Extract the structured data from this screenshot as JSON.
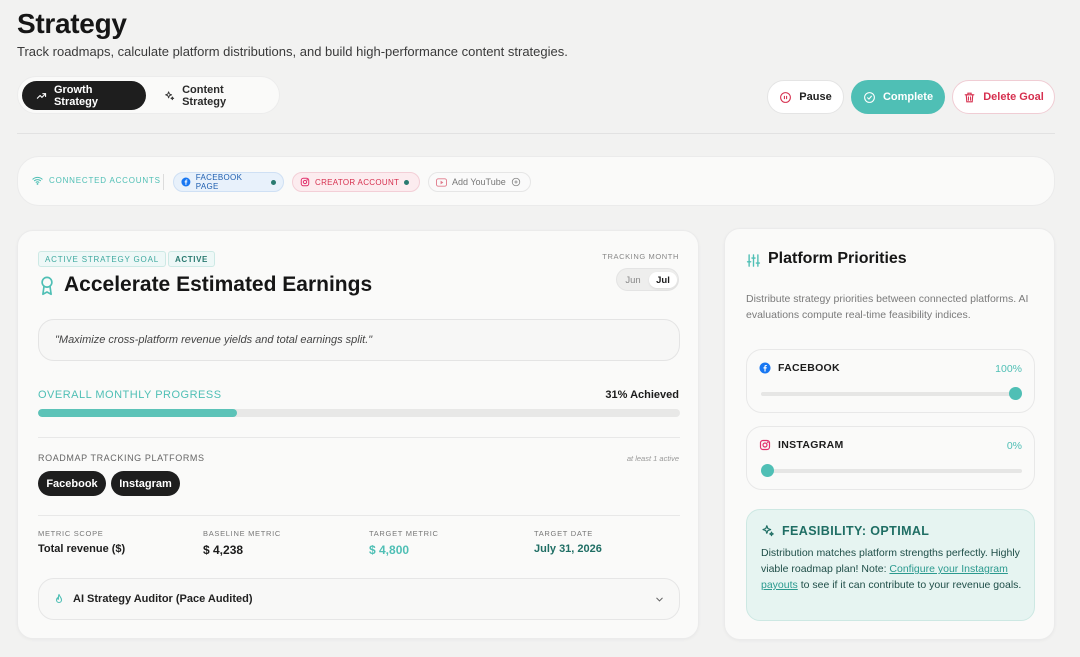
{
  "header": {
    "title": "Strategy",
    "subtitle": "Track roadmaps, calculate platform distributions, and build high-performance content strategies."
  },
  "tabs": [
    {
      "label": "Growth Strategy",
      "icon": "trending-up-icon",
      "active": true
    },
    {
      "label": "Content Strategy",
      "icon": "sparkles-icon",
      "active": false
    }
  ],
  "actions": {
    "pause": "Pause",
    "complete": "Complete",
    "delete": "Delete Goal"
  },
  "accounts": {
    "label": "CONNECTED ACCOUNTS",
    "facebook": "FACEBOOK PAGE",
    "instagram": "CREATOR ACCOUNT",
    "youtube": "Add YouTube"
  },
  "goal": {
    "tag": "ACTIVE STRATEGY GOAL",
    "status": "ACTIVE",
    "title": "Accelerate Estimated Earnings",
    "tracking_label": "TRACKING MONTH",
    "months": [
      "Jun",
      "Jul"
    ],
    "selected_month": "Jul",
    "quote": "\"Maximize cross-platform revenue yields and total earnings split.\"",
    "progress_label": "OVERALL MONTHLY PROGRESS",
    "progress_text": "31% Achieved",
    "progress_value": 0.31,
    "platforms_label": "ROADMAP TRACKING PLATFORMS",
    "platforms_hint": "at least 1 active",
    "platforms": [
      "Facebook",
      "Instagram"
    ],
    "metrics": {
      "scope_label": "METRIC SCOPE",
      "scope_value": "Total revenue ($)",
      "baseline_label": "BASELINE METRIC",
      "baseline_value": "$ 4,238",
      "target_label": "TARGET METRIC",
      "target_value": "$ 4,800",
      "date_label": "TARGET DATE",
      "date_value": "July 31, 2026"
    },
    "auditor": "AI Strategy Auditor (Pace Audited)"
  },
  "priorities": {
    "title": "Platform Priorities",
    "description": "Distribute strategy priorities between connected platforms. AI evaluations compute real-time feasibility indices.",
    "facebook": {
      "name": "FACEBOOK",
      "pct": "100%",
      "value": 1.0
    },
    "instagram": {
      "name": "INSTAGRAM",
      "pct": "0%",
      "value": 0.0
    },
    "feasibility": {
      "title": "FEASIBILITY: OPTIMAL",
      "text1": "Distribution matches platform strengths perfectly. Highly viable roadmap plan! Note: ",
      "link": "Configure your Instagram payouts",
      "text2": " to see if it can contribute to your revenue goals."
    }
  },
  "colors": {
    "accent": "#4fbfb5",
    "danger": "#d6304f",
    "facebook": "#1877f2",
    "instagram": "#e1306c"
  }
}
